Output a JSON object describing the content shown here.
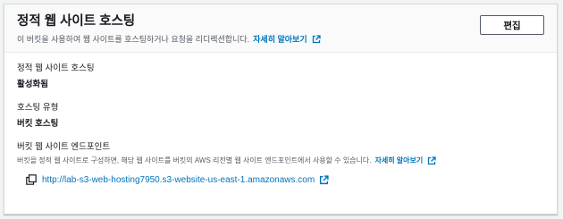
{
  "section": {
    "title": "정적 웹 사이트 호스팅",
    "description": "이 버킷을 사용하여 웹 사이트를 호스팅하거나 요청을 리디렉션합니다.",
    "learn_more": "자세히 알아보기",
    "edit_label": "편집"
  },
  "fields": {
    "hosting_label": "정적 웹 사이트 호스팅",
    "hosting_value": "활성화됨",
    "type_label": "호스팅 유형",
    "type_value": "버킷 호스팅",
    "endpoint_label": "버킷 웹 사이트 엔드포인트",
    "endpoint_description": "버킷을 정적 웹 사이트로 구성하면, 해당 웹 사이트를 버킷의 AWS 리전별 웹 사이트 엔드포인트에서 사용할 수 있습니다.",
    "endpoint_learn_more": "자세히 알아보기",
    "endpoint_url": "http://lab-s3-web-hosting7950.s3-website-us-east-1.amazonaws.com"
  },
  "colors": {
    "link": "#0073bb",
    "text": "#16191f",
    "muted": "#545b64"
  },
  "icons": [
    "external-link-icon",
    "copy-icon"
  ]
}
